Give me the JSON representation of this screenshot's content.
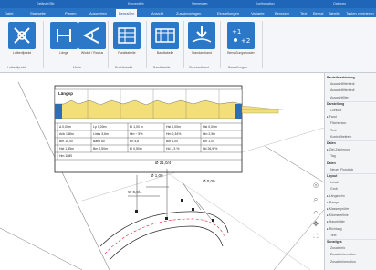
{
  "titlebar": {
    "texts": [
      "Gelände/Stb",
      "Konzeptleb",
      "Vermessen",
      "Konfiguration",
      "Optionen"
    ]
  },
  "tabs": [
    "Datei",
    "Startseite",
    "Planen",
    "Auswerten",
    "Bemaßen",
    "Ansicht",
    "Zusatzvorlagen",
    "Einstellungen",
    "Variante",
    "Benutzer",
    "Text",
    "Bemal",
    "Tabelle",
    "Tasten zentrieren"
  ],
  "ribbon": {
    "buttons": [
      {
        "label": "Lotbedfpunkt",
        "icon": "x-cross-icon"
      },
      {
        "label": "Länge",
        "icon": "length-icon"
      },
      {
        "label": "Winkel / Radius",
        "icon": "angle-icon"
      },
      {
        "label": "Punkttabelle",
        "icon": "point-table-icon"
      },
      {
        "label": "Bandtabelle",
        "icon": "band-table-icon"
      },
      {
        "label": "Standardband",
        "icon": "standard-band-icon"
      },
      {
        "label": "Bemaßungsmuster",
        "icon": "dimension-pattern-icon"
      }
    ],
    "groups": [
      "Lotbedfpunkt",
      "Maße",
      "Punkttabelle",
      "Bandtabelle",
      "Standardband",
      "Bemaßungen"
    ]
  },
  "table": {
    "title": "Längsp",
    "rows": [
      [
        "Δ 0,00m",
        "Lp 0,00m",
        "Bl 1,00 m",
        "Hst 0,00m",
        "Hst 0,00m"
      ],
      [
        "Ank 148m",
        "Links 3,6m",
        "Hm ~ 5%",
        "Hm 0,34%",
        "Hm 2,5m"
      ],
      [
        "Bm 10,00",
        "Bank 80",
        "Bn 4,8",
        "Bm 1,00",
        "Bm 1,00"
      ],
      [
        "Hst 1,35m",
        "Bm 0,50m",
        "Bl 0,50m",
        "Hd 1,3 %",
        "Hd 26,9 %"
      ],
      [
        "Hm 1880",
        "",
        "",
        "",
        ""
      ]
    ]
  },
  "dimensions": {
    "d1": "Ø 21,0/4",
    "d2": "Ø 1,00",
    "d3": "Ø 0,00",
    "d4": "W 0,0/4"
  },
  "panel": {
    "items": [
      {
        "text": "Bauteilmarkierung",
        "type": "hd"
      },
      {
        "text": "Auswahlfilterbedi",
        "type": "ind"
      },
      {
        "text": "Auswahlfilterbedi",
        "type": "ind"
      },
      {
        "text": "Auswahlfilter",
        "type": "ind"
      },
      {
        "text": "Darstellung",
        "type": "hd"
      },
      {
        "text": "Contour",
        "type": "ind"
      },
      {
        "text": "▸ Fand",
        "type": "n"
      },
      {
        "text": "Flächenton",
        "type": "ind"
      },
      {
        "text": "Text",
        "type": "ind"
      },
      {
        "text": "Kontrollbeitrein",
        "type": "ind"
      },
      {
        "text": "Daten",
        "type": "hd"
      },
      {
        "text": "▸ Ziel-Zeichnung",
        "type": "n"
      },
      {
        "text": "Tag",
        "type": "ind"
      },
      {
        "text": "Daten",
        "type": "hd"
      },
      {
        "text": "Neues Flurstück",
        "type": "ind"
      },
      {
        "text": "Layout",
        "type": "hd"
      },
      {
        "text": "Inhalt",
        "type": "ind"
      },
      {
        "text": "Grob",
        "type": "ind"
      },
      {
        "text": "▸ Längsschn",
        "type": "n"
      },
      {
        "text": "▸ Rampe",
        "type": "n"
      },
      {
        "text": "▸ Klassenprüfer",
        "type": "n"
      },
      {
        "text": "▸ Kilometerlinie",
        "type": "n"
      },
      {
        "text": "▸ Hauptgitter",
        "type": "n"
      },
      {
        "text": "▸ Richtung",
        "type": "n"
      },
      {
        "text": "Text",
        "type": "ind"
      },
      {
        "text": "Sonstiges",
        "type": "hd"
      },
      {
        "text": "Zusatzinfo",
        "type": "ind"
      },
      {
        "text": "Zusatzinformation",
        "type": "ind"
      },
      {
        "text": "Zusatzinformation",
        "type": "ind"
      }
    ]
  },
  "navtools": [
    "walk-icon",
    "zoom-in-icon",
    "zoom-out-icon",
    "pan-icon",
    "fit-icon"
  ]
}
